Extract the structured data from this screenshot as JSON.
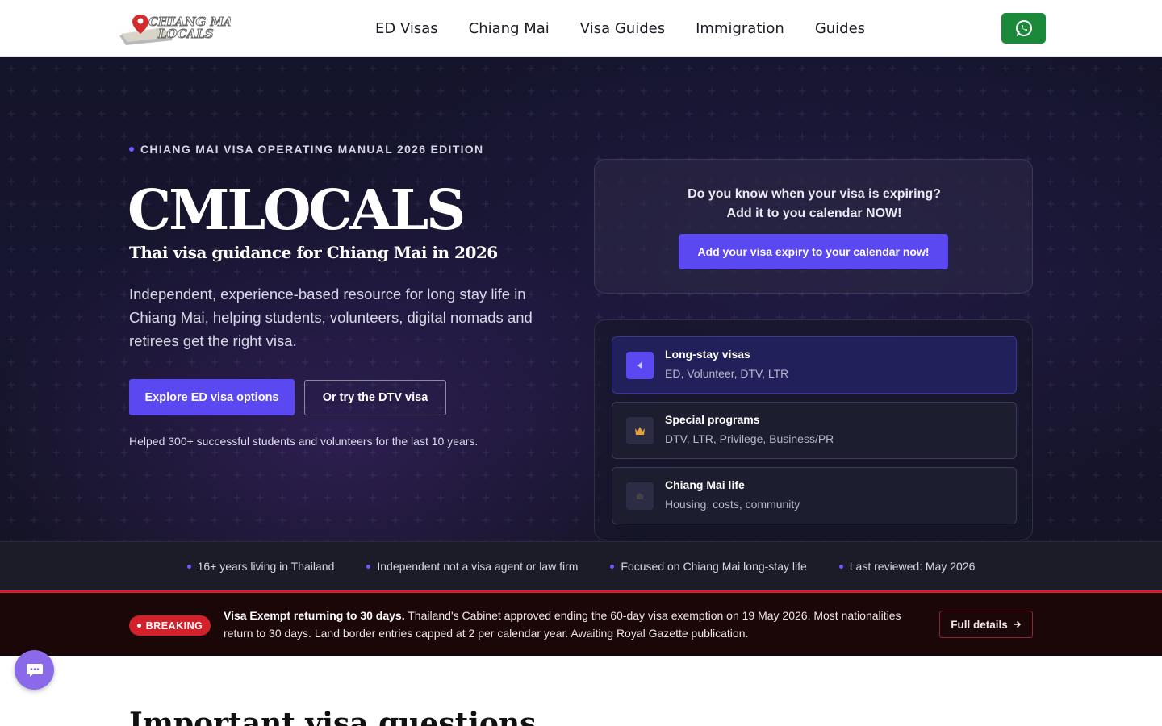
{
  "header": {
    "logo_text": "CHIANG MAI LOCALS",
    "nav": [
      "ED Visas",
      "Chiang Mai",
      "Visa Guides",
      "Immigration",
      "Guides"
    ],
    "whatsapp_icon": "whatsapp-icon"
  },
  "hero": {
    "eyebrow": "CHIANG MAI VISA OPERATING MANUAL 2026 EDITION",
    "title": "CMLOCALS",
    "subtitle": "Thai visa guidance for Chiang Mai in 2026",
    "description": "Independent, experience-based resource for long stay life in Chiang Mai, helping students, volunteers, digital nomads and retirees get the right visa.",
    "primary_button": "Explore ED visa options",
    "secondary_button": "Or try the DTV visa",
    "helped": "Helped 300+ successful students and volunteers for the last 10 years."
  },
  "calendar_card": {
    "question_line1": "Do you know when your visa is expiring?",
    "question_line2": "Add it to you calendar NOW!",
    "button": "Add your visa expiry to your calendar now!"
  },
  "categories": [
    {
      "title": "Long-stay visas",
      "subtitle": "ED, Volunteer, DTV, LTR",
      "icon": "arrow-left-icon"
    },
    {
      "title": "Special programs",
      "subtitle": "DTV, LTR, Privilege, Business/PR",
      "icon": "crown-icon"
    },
    {
      "title": "Chiang Mai life",
      "subtitle": "Housing, costs, community",
      "icon": "home-icon"
    }
  ],
  "stats": [
    "16+ years living in Thailand",
    "Independent not a visa agent or law firm",
    "Focused on Chiang Mai long-stay life",
    "Last reviewed: May 2026"
  ],
  "breaking": {
    "badge": "BREAKING",
    "headline": "Visa Exempt returning to 30 days.",
    "body": " Thailand's Cabinet approved ending the 60-day visa exemption on 19 May 2026. Most nationalities return to 30 days. Land border entries capped at 2 per calendar year. Awaiting Royal Gazette publication.",
    "button": "Full details"
  },
  "next_section": {
    "heading": "Important visa questions"
  },
  "colors": {
    "accent": "#5a48f0",
    "breaking_red": "#d3212c",
    "whatsapp_green": "#1a8a3a",
    "hero_bg": "#161529"
  }
}
